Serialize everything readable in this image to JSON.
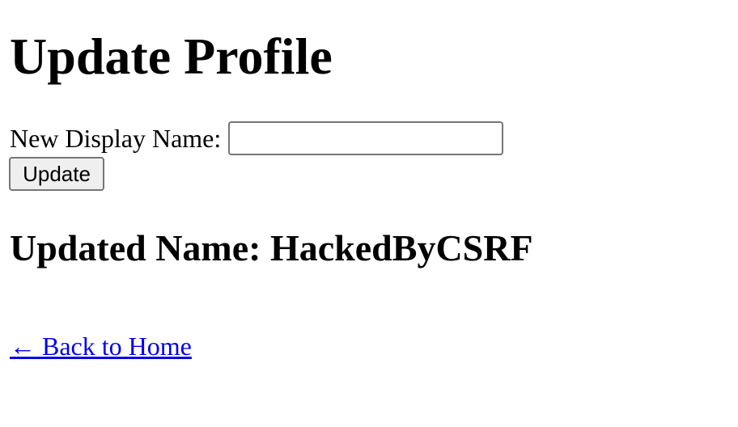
{
  "page": {
    "title": "Update Profile"
  },
  "form": {
    "label": "New Display Name:",
    "input_value": "",
    "button_label": "Update"
  },
  "result": {
    "heading": "Updated Name: HackedByCSRF"
  },
  "nav": {
    "back_link": "← Back to Home"
  },
  "colors": {
    "link": "#0000ee",
    "text": "#000000",
    "background": "#ffffff",
    "button_bg": "#efefef"
  }
}
